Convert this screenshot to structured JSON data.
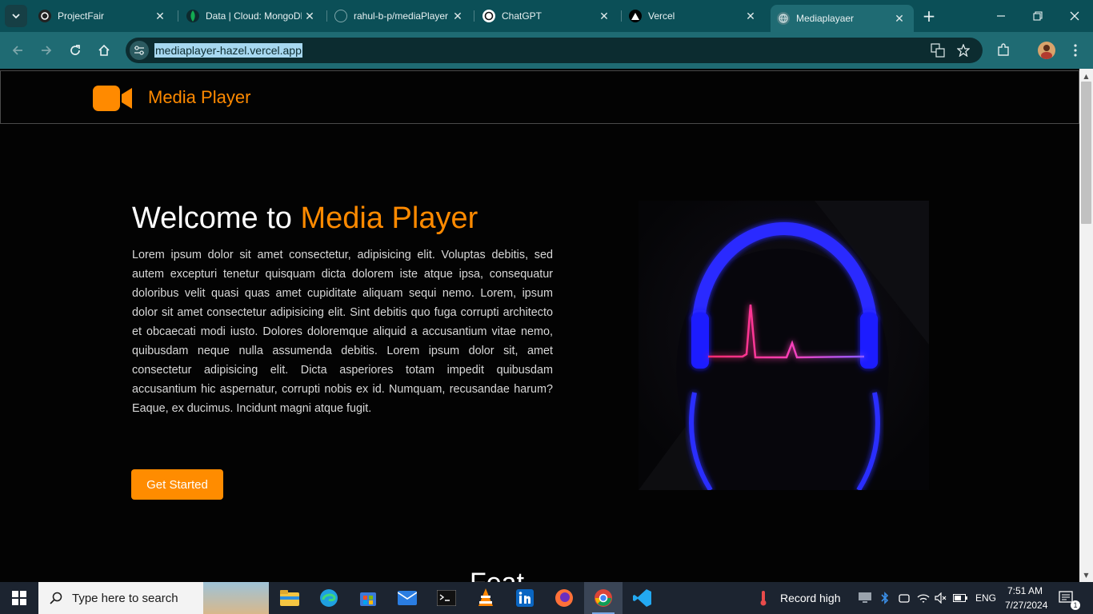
{
  "browser": {
    "tabs": [
      {
        "title": "ProjectFair",
        "favicon": "projectfair-icon"
      },
      {
        "title": "Data | Cloud: MongoDB",
        "favicon": "mongodb-leaf-icon"
      },
      {
        "title": "rahul-b-p/mediaPlayer",
        "favicon": "github-icon"
      },
      {
        "title": "ChatGPT",
        "favicon": "chatgpt-icon"
      },
      {
        "title": "Vercel",
        "favicon": "vercel-icon"
      },
      {
        "title": "Mediaplayaer",
        "favicon": "globe-icon",
        "active": true
      }
    ],
    "url": "mediaplayer-hazel.vercel.app"
  },
  "page": {
    "brand_name": "Media Player",
    "hero": {
      "title_prefix": "Welcome to ",
      "title_accent": "Media Player",
      "description": "Lorem ipsum dolor sit amet consectetur, adipisicing elit. Voluptas debitis, sed autem excepturi tenetur quisquam dicta dolorem iste atque ipsa, consequatur doloribus velit quasi quas amet cupiditate aliquam sequi nemo. Lorem, ipsum dolor sit amet consectetur adipisicing elit. Sint debitis quo fuga corrupti architecto et obcaecati modi iusto. Dolores doloremque aliquid a accusantium vitae nemo, quibusdam neque nulla assumenda debitis. Lorem ipsum dolor sit, amet consectetur adipisicing elit. Dicta asperiores totam impedit quibusdam accusantium hic aspernatur, corrupti nobis ex id. Numquam, recusandae harum? Eaque, ex ducimus. Incidunt magni atque fugit.",
      "cta_label": "Get Started"
    },
    "next_section_heading_partial": "Feat"
  },
  "colors": {
    "accent": "#ff8a00",
    "page_bg": "#030303",
    "chrome_tab": "#1f6b73"
  },
  "taskbar": {
    "search_placeholder": "Type here to search",
    "weather_text": "Record high",
    "language": "ENG",
    "time": "7:51 AM",
    "date": "7/27/2024",
    "notification_count": "1",
    "pinned": [
      "file-explorer-icon",
      "edge-icon",
      "store-icon",
      "mail-icon",
      "terminal-icon",
      "vlc-icon",
      "linkedin-icon",
      "firefox-icon",
      "chrome-icon",
      "vscode-icon"
    ]
  }
}
